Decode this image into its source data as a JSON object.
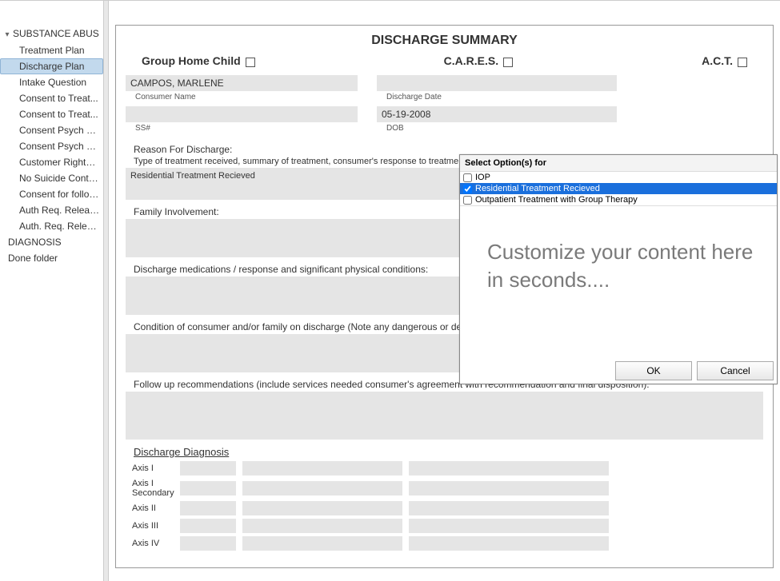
{
  "sidebar": {
    "root": "SUBSTANCE ABUS",
    "items": [
      "Treatment Plan",
      "Discharge Plan",
      "Intake Question",
      "Consent to Treat...",
      "Consent to Treat...",
      "Consent Psych M...",
      "Consent Psych M...",
      "Customer Rights (...",
      "No Suicide Contract",
      "Consent for follow...",
      "Auth Req. Releas...",
      "Auth. Req. Relea..."
    ],
    "selected_index": 1,
    "extra": [
      "DIAGNOSIS",
      "Done folder"
    ]
  },
  "doc": {
    "title": "DISCHARGE SUMMARY",
    "checks": {
      "group_home": "Group Home Child",
      "cares": "C.A.R.E.S.",
      "act": "A.C.T."
    },
    "consumer_name": "CAMPOS, MARLENE",
    "consumer_name_label": "Consumer Name",
    "ss_label": "SS#",
    "discharge_date_label": "Discharge Date",
    "dob_label": "DOB",
    "dob_value": "05-19-2008",
    "reason_head": "Reason For Discharge:",
    "reason_sub": "Type of treatment received, summary of treatment, consumer's response to treatment, unresolved problems.",
    "reason_value": "Residential Treatment Recieved",
    "family_head": "Family Involvement:",
    "meds_head": "Discharge medications / response and significant physical conditions:",
    "condition_head": "Condition of consumer and/or family on discharge (Note any dangerous or destructive tendencies):",
    "followup_head": "Follow up recommendations (include services needed consumer's agreement with recommendation and final disposition):",
    "diag_head": "Discharge Diagnosis",
    "axes": [
      "Axis I",
      "Axis I Secondary",
      "Axis II",
      "Axis III",
      "Axis IV"
    ]
  },
  "popup": {
    "title": "Select Option(s) for",
    "options": [
      {
        "label": "IOP",
        "checked": false,
        "selected": false
      },
      {
        "label": "Residential Treatment Recieved",
        "checked": true,
        "selected": true
      },
      {
        "label": "Outpatient Treatment with Group Therapy",
        "checked": false,
        "selected": false
      }
    ],
    "body": "Customize your content here in seconds....",
    "ok": "OK",
    "cancel": "Cancel"
  }
}
